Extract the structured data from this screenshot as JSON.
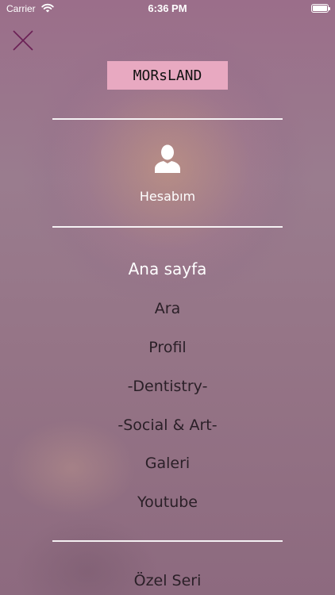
{
  "status_bar": {
    "carrier": "Carrier",
    "time": "6:36 PM",
    "battery_level": 1.0
  },
  "header": {
    "logo_text": "MORsLAND"
  },
  "account": {
    "icon": "person-icon",
    "label": "Hesabım"
  },
  "menu": {
    "items": [
      {
        "label": "Ana sayfa",
        "active": true
      },
      {
        "label": "Ara"
      },
      {
        "label": "Profil"
      },
      {
        "label": "-Dentistry-"
      },
      {
        "label": "-Social & Art-"
      },
      {
        "label": "Galeri"
      },
      {
        "label": "Youtube"
      }
    ],
    "extra": [
      {
        "label": "Özel Seri"
      }
    ]
  },
  "colors": {
    "logo_bg": "#e8a9c1",
    "close_icon": "#6b1f55",
    "divider": "#ffffff",
    "active_text": "#ffffff",
    "item_text": "#2a1f27"
  }
}
